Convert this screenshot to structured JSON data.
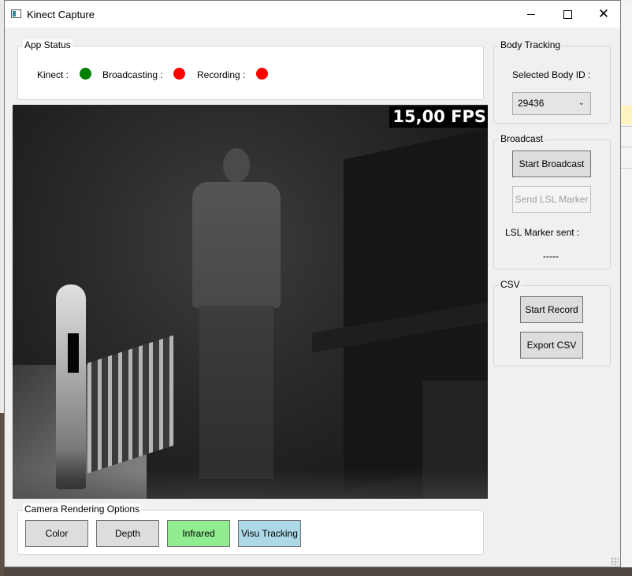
{
  "window": {
    "title": "Kinect Capture"
  },
  "app_status": {
    "legend": "App Status",
    "kinect_label": "Kinect :",
    "broadcasting_label": "Broadcasting :",
    "recording_label": "Recording :",
    "kinect_color": "#008000",
    "broadcasting_color": "#ff0000",
    "recording_color": "#ff0000"
  },
  "camera": {
    "fps": "15,00 FPS"
  },
  "body_tracking": {
    "legend": "Body Tracking",
    "selected_label": "Selected Body ID :",
    "selected_value": "29436"
  },
  "broadcast": {
    "legend": "Broadcast",
    "start_label": "Start Broadcast",
    "send_marker_label": "Send LSL Marker",
    "marker_sent_label": "LSL Marker sent :",
    "marker_sent_value": "-----"
  },
  "csv": {
    "legend": "CSV",
    "start_record_label": "Start Record",
    "export_label": "Export CSV"
  },
  "render_options": {
    "legend": "Camera Rendering Options",
    "buttons": [
      "Color",
      "Depth",
      "Infrared",
      "Visu Tracking"
    ],
    "colors": {
      "default": "#dddddd",
      "infrared_active": "#90ee90",
      "visu_tracking_active": "#add8e6"
    }
  }
}
